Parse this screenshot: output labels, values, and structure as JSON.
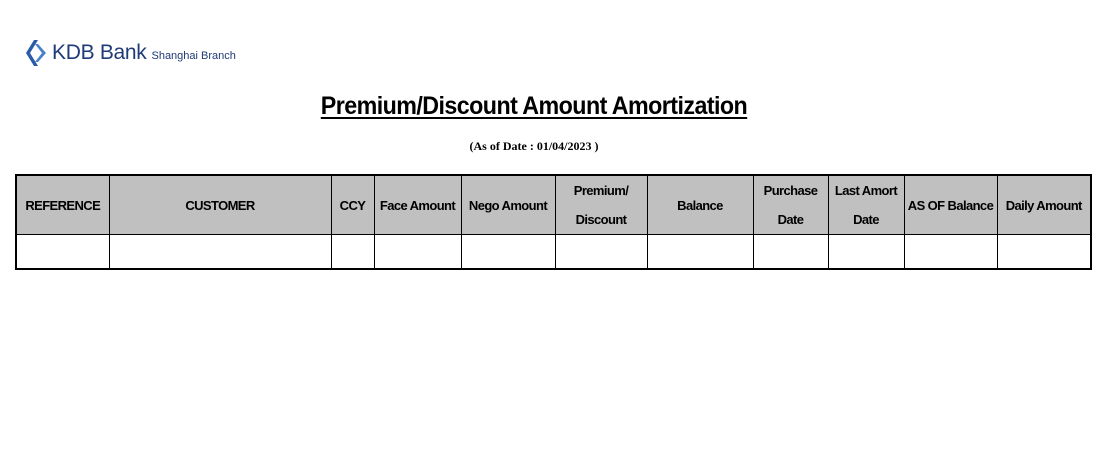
{
  "logo": {
    "name": "KDB Bank",
    "sub": "Shanghai Branch",
    "color": "#1f3a78",
    "icon": "kdb-logo-icon"
  },
  "title": "Premium/Discount Amount Amortization",
  "as_of_text": "(As of Date : 01/04/2023 )",
  "table": {
    "header_bg": "#c0c0c0",
    "columns": [
      "REFERENCE",
      "CUSTOMER",
      "CCY",
      "Face Amount",
      "Nego Amount",
      "Premium/\nDiscount",
      "Balance",
      "Purchase\nDate",
      "Last Amort\nDate",
      "AS OF Balance",
      "Daily Amount"
    ],
    "rows": [
      [
        "",
        "",
        "",
        "",
        "",
        "",
        "",
        "",
        "",
        "",
        ""
      ]
    ]
  }
}
